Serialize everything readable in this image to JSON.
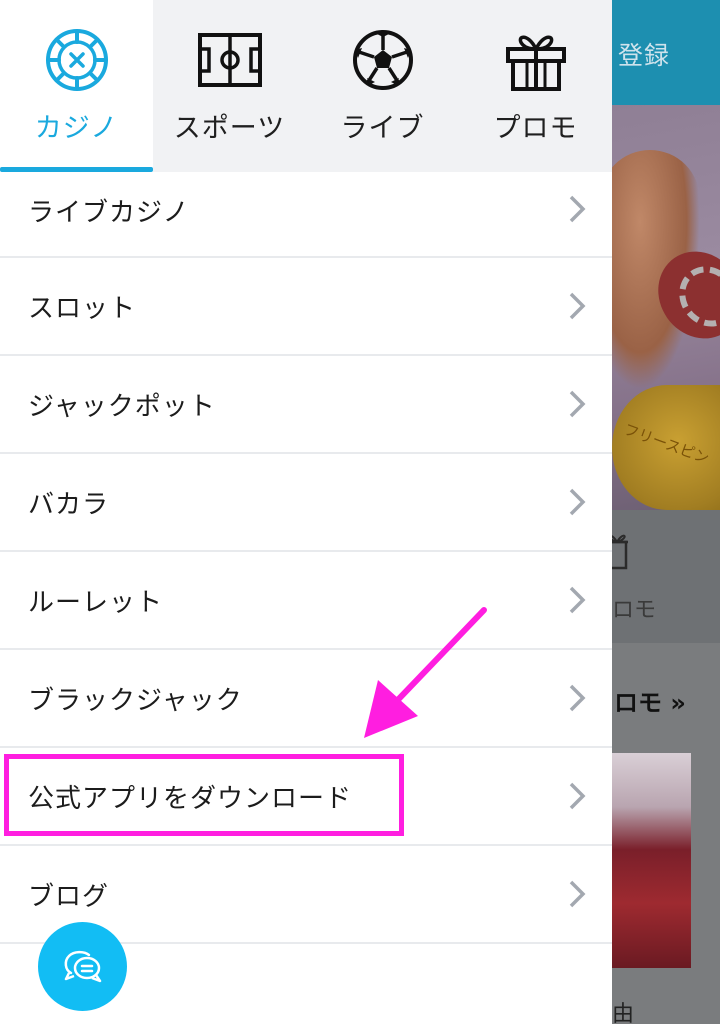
{
  "background_page": {
    "register_label": "登録",
    "coin_text": "フリースピン",
    "promo_label": "ロモ",
    "section_title": "ロモ »",
    "card_caption": "由"
  },
  "tabs": [
    {
      "label": "カジノ",
      "icon": "roulette-icon",
      "active": true
    },
    {
      "label": "スポーツ",
      "icon": "soccer-field-icon",
      "active": false
    },
    {
      "label": "ライブ",
      "icon": "soccer-ball-icon",
      "active": false
    },
    {
      "label": "プロモ",
      "icon": "gift-icon",
      "active": false
    }
  ],
  "menu": [
    {
      "label": "ライブカジノ"
    },
    {
      "label": "スロット"
    },
    {
      "label": "ジャックポット"
    },
    {
      "label": "バカラ"
    },
    {
      "label": "ルーレット"
    },
    {
      "label": "ブラックジャック"
    },
    {
      "label": "公式アプリをダウンロード",
      "highlighted": true
    },
    {
      "label": "ブログ"
    }
  ],
  "colors": {
    "accent": "#1aa9de",
    "highlight": "#ff1ee0",
    "chat_button": "#12bdf4",
    "tab_bar": "#f1f2f4",
    "header_bg": "#1d8fb0"
  },
  "chat_button": {
    "icon": "chat-bubble-icon"
  }
}
